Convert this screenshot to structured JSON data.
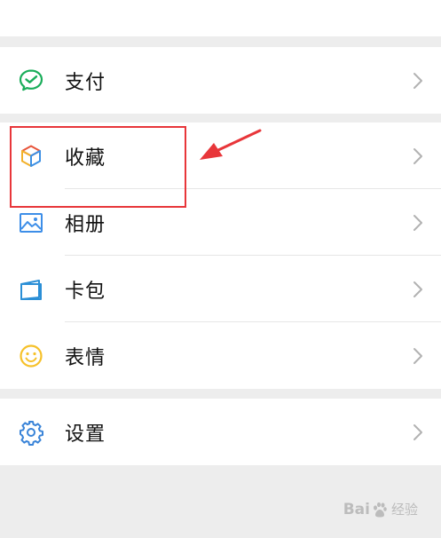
{
  "menu_groups": [
    {
      "items": [
        {
          "label": "支付",
          "icon": "wechat-pay-icon"
        }
      ]
    },
    {
      "items": [
        {
          "label": "收藏",
          "icon": "favorites-cube-icon"
        },
        {
          "label": "相册",
          "icon": "album-image-icon"
        },
        {
          "label": "卡包",
          "icon": "card-wallet-icon"
        },
        {
          "label": "表情",
          "icon": "sticker-smiley-icon"
        }
      ]
    },
    {
      "items": [
        {
          "label": "设置",
          "icon": "settings-gear-icon"
        }
      ]
    }
  ],
  "colors": {
    "background": "#ededed",
    "row_background": "#ffffff",
    "pay_green": "#1aad5a",
    "album_blue": "#3d8ee8",
    "card_teal": "#2b8fd6",
    "sticker_yellow": "#f6c12a",
    "settings_blue": "#3a84d8",
    "annotation_red": "#e8363a",
    "chevron": "#b2b2b2"
  },
  "watermark": {
    "brand": "Bai",
    "brand_suffix": "经验",
    "icon": "baidu-paw-icon"
  }
}
